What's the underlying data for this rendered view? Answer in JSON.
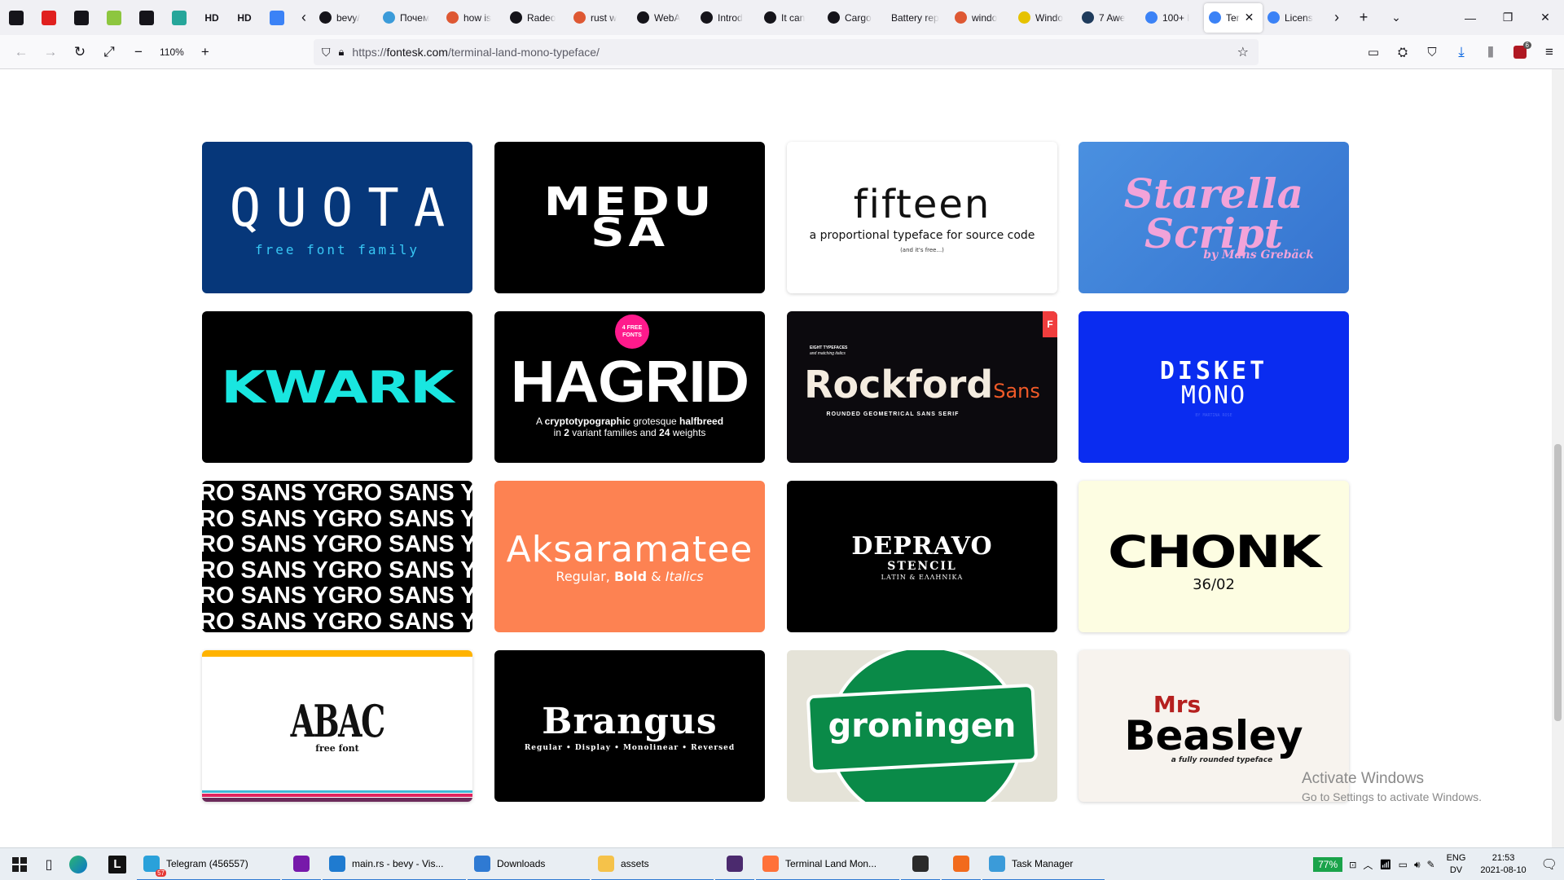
{
  "browser": {
    "pinned_tabs": [
      {
        "icon": "notebook-icon",
        "color": "#15141a",
        "text": ""
      },
      {
        "icon": "opera-icon",
        "color": "#e0201f",
        "text": ""
      },
      {
        "icon": "circle-arrow-icon",
        "color": "#15141a",
        "text": ""
      },
      {
        "icon": "leaf-icon",
        "color": "#8dc63f",
        "text": ""
      },
      {
        "icon": "notebook-icon",
        "color": "#15141a",
        "text": ""
      },
      {
        "icon": "chart-icon",
        "color": "#26a69a",
        "text": ""
      },
      {
        "icon": "hd-icon",
        "color": "#15141a",
        "text": "HD"
      },
      {
        "icon": "hd-icon",
        "color": "#15141a",
        "text": "HD"
      },
      {
        "icon": "globe-icon",
        "color": "#3b82f6",
        "text": ""
      }
    ],
    "tabs": [
      {
        "title": "bevy/",
        "icon": "github-icon",
        "color": "#15141a"
      },
      {
        "title": "Почем",
        "icon": "window-icon",
        "color": "#3b9bd9"
      },
      {
        "title": "how is",
        "icon": "ddg-icon",
        "color": "#de5833"
      },
      {
        "title": "Radeo",
        "icon": "radeon-icon",
        "color": "#15141a"
      },
      {
        "title": "rust w",
        "icon": "ddg-icon",
        "color": "#de5833"
      },
      {
        "title": "WebA",
        "icon": "webassembly-icon",
        "color": "#15141a"
      },
      {
        "title": "Introd",
        "icon": "notebook-icon",
        "color": "#15141a"
      },
      {
        "title": "It can",
        "icon": "github-icon",
        "color": "#15141a"
      },
      {
        "title": "Cargo",
        "icon": "notebook-icon",
        "color": "#15141a"
      },
      {
        "title": "Battery rep",
        "icon": "",
        "color": ""
      },
      {
        "title": "windo",
        "icon": "ddg-icon",
        "color": "#de5833"
      },
      {
        "title": "Windo",
        "icon": "w-icon",
        "color": "#e6c200"
      },
      {
        "title": "7 Awe",
        "icon": "news-icon",
        "color": "#1f3b5c"
      },
      {
        "title": "100+ l",
        "icon": "fontesk-icon",
        "color": "#3b82f6"
      },
      {
        "title": "Ter",
        "icon": "fontesk-icon",
        "color": "#3b82f6",
        "active": true
      },
      {
        "title": "Licens",
        "icon": "fontesk-icon",
        "color": "#3b82f6"
      }
    ],
    "zoom": "110%",
    "url_prefix": "https://",
    "url_host": "fontesk.com",
    "url_path": "/terminal-land-mono-typeface/",
    "extension_badge": "6"
  },
  "cards": [
    {
      "name": "quota",
      "bg": "#06377a",
      "line1": "QUOTA",
      "line2": "free font family"
    },
    {
      "name": "medusa",
      "bg": "#000000",
      "line1": "MEDUSA",
      "line2": ""
    },
    {
      "name": "fifteen",
      "bg": "#ffffff",
      "line1": "fifteen",
      "line2": "a proportional typeface for source code",
      "line3": "(and it's free...)"
    },
    {
      "name": "starella",
      "bg": "#3f86dd",
      "line1": "Starella",
      "line2": "Script",
      "line3": "by Mans Grebäck"
    },
    {
      "name": "kwark",
      "bg": "#000000",
      "line1": "KWARK",
      "line2": ""
    },
    {
      "name": "hagrid",
      "bg": "#000000",
      "badge": "4 FREE FONTS",
      "line1": "HAGRID",
      "line2a": "A ",
      "line2b": "cryptotypographic",
      "line2c": " grotesque ",
      "line2d": "halfbreed",
      "line3a": "in ",
      "line3b": "2",
      "line3c": " variant families and ",
      "line3d": "24",
      "line3e": " weights"
    },
    {
      "name": "rockford",
      "bg": "#0c0a0e",
      "tiny1": "EIGHT TYPEFACES",
      "tiny2": "and matching italics",
      "line1": "Rockford",
      "line1b": "Sans",
      "line2": "ROUNDED GEOMETRICAL SANS SERIF",
      "corner": "F"
    },
    {
      "name": "disket",
      "bg": "#0a2cf0",
      "line1": "DISKET",
      "line2": "MONO",
      "line3": "BY MARTINA ROSE"
    },
    {
      "name": "ygro",
      "bg": "#000000",
      "line1": "RO SANS YGRO SANS YG"
    },
    {
      "name": "aksaramatee",
      "bg": "#fd8252",
      "line1": "Aksaramatee",
      "line2a": "Regular, ",
      "line2b": "Bold",
      "line2c": " & ",
      "line2d": "Italics"
    },
    {
      "name": "depravo",
      "bg": "#000000",
      "line1": "DEPRAVO",
      "line2": "STENCIL",
      "line3": "LATIN & ΕΛΛΗΝΙΚΑ"
    },
    {
      "name": "chonk",
      "bg": "#fdfde2",
      "line1": "CHONK",
      "line2": "36/02"
    },
    {
      "name": "abac",
      "bg": "#ffffff",
      "line1": "ABAC",
      "line2": "free font"
    },
    {
      "name": "brangus",
      "bg": "#000000",
      "line1": "Brangus",
      "line2": "Regular • Display • Monolinear • Reversed"
    },
    {
      "name": "groningen",
      "bg": "#e5e3d8",
      "line1": "groningen"
    },
    {
      "name": "beasley",
      "bg": "#f7f3ee",
      "line1": "Mrs",
      "line2": "Beasley",
      "line3": "a fully rounded typeface"
    }
  ],
  "watermark": {
    "title": "Activate Windows",
    "sub": "Go to Settings to activate Windows."
  },
  "taskbar": {
    "apps": [
      {
        "label": "Telegram (456557)",
        "icon": "telegram-icon",
        "color": "#2aa1da",
        "badge": "57"
      },
      {
        "label": "",
        "icon": "onenote-icon",
        "color": "#7719aa"
      },
      {
        "label": "main.rs - bevy - Vis...",
        "icon": "vscode-icon",
        "color": "#1f7bd0"
      },
      {
        "label": "Downloads",
        "icon": "download-icon",
        "color": "#2f7ad3"
      },
      {
        "label": "assets",
        "icon": "folder-icon",
        "color": "#f5c24a"
      },
      {
        "label": "",
        "icon": "app-icon",
        "color": "#4b2a6e"
      },
      {
        "label": "Terminal Land Mon...",
        "icon": "firefox-icon",
        "color": "#ff7139"
      },
      {
        "label": "",
        "icon": "terminal-icon",
        "color": "#2b2b2b"
      },
      {
        "label": "",
        "icon": "equalizer-icon",
        "color": "#f26b1d"
      },
      {
        "label": "Task Manager",
        "icon": "taskmanager-icon",
        "color": "#3b9bd9"
      }
    ],
    "battery": "77%",
    "lang": "ENG",
    "lang2": "DV",
    "time": "21:53",
    "date": "2021-08-10"
  }
}
